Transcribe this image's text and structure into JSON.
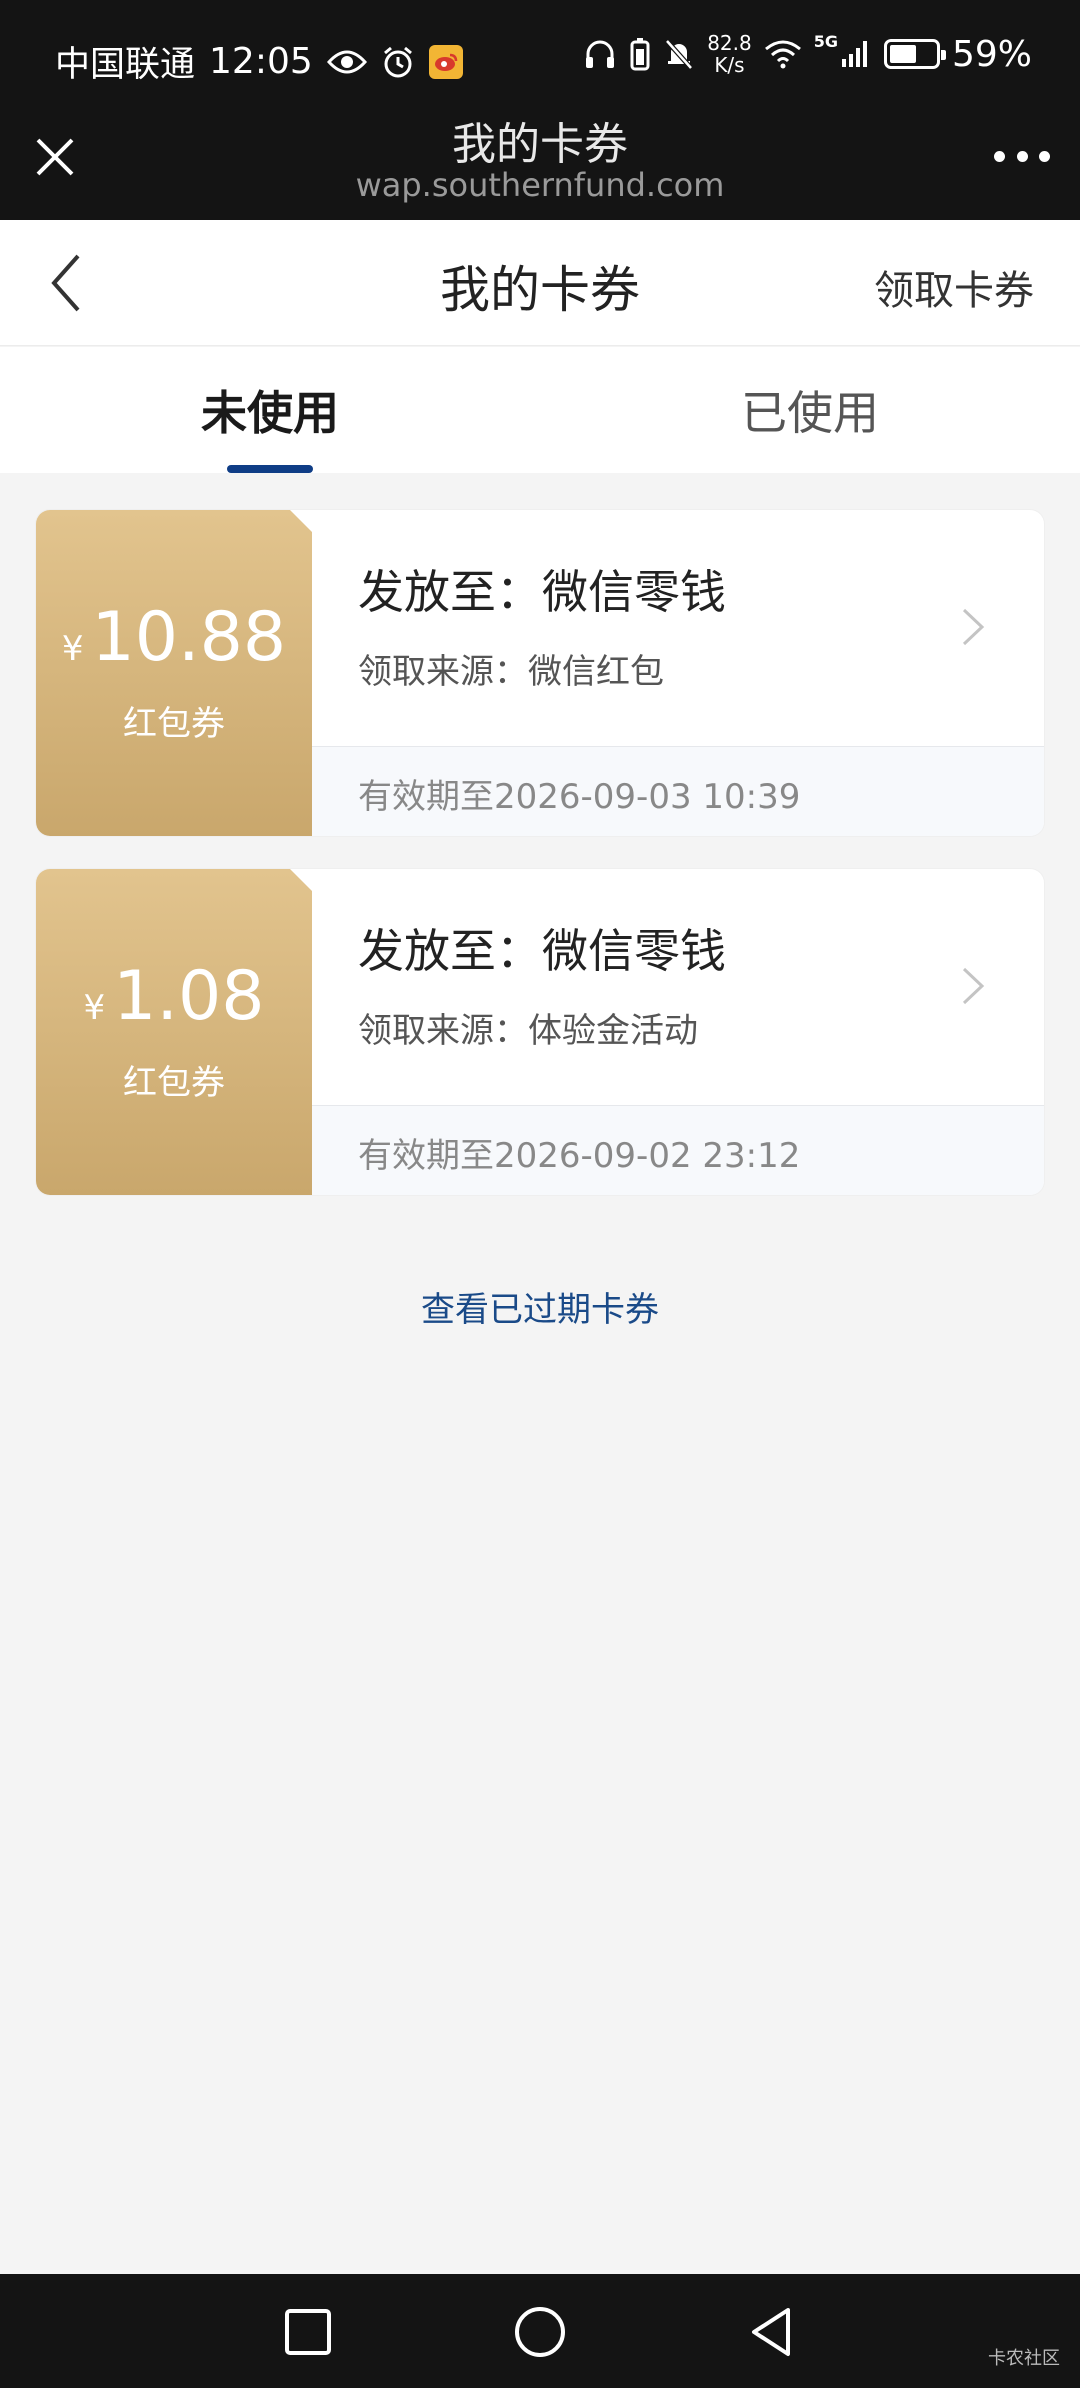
{
  "status_bar": {
    "carrier": "中国联通",
    "time": "12:05",
    "net_speed_value": "82.8",
    "net_speed_unit": "K/s",
    "signal_label": "5G",
    "battery_percent": "59%",
    "battery_level": 0.59
  },
  "browser": {
    "title": "我的卡券",
    "url": "wap.southernfund.com"
  },
  "header": {
    "title": "我的卡券",
    "claim_label": "领取卡券"
  },
  "tabs": [
    {
      "label": "未使用",
      "active": true
    },
    {
      "label": "已使用",
      "active": false
    }
  ],
  "coupons": [
    {
      "currency": "¥",
      "amount": "10.88",
      "type": "红包券",
      "destination": "发放至：微信零钱",
      "source": "领取来源：微信红包",
      "validity": "有效期至2026-09-03 10:39"
    },
    {
      "currency": "¥",
      "amount": "1.08",
      "type": "红包券",
      "destination": "发放至：微信零钱",
      "source": "领取来源：体验金活动",
      "validity": "有效期至2026-09-02 23:12"
    }
  ],
  "expired_link": "查看已过期卡券",
  "watermark": "卡农社区",
  "colors": {
    "accent": "#0f3d86",
    "coupon_gold_top": "#e2c48e",
    "coupon_gold_bottom": "#c9a76c",
    "link": "#1a4a88"
  }
}
